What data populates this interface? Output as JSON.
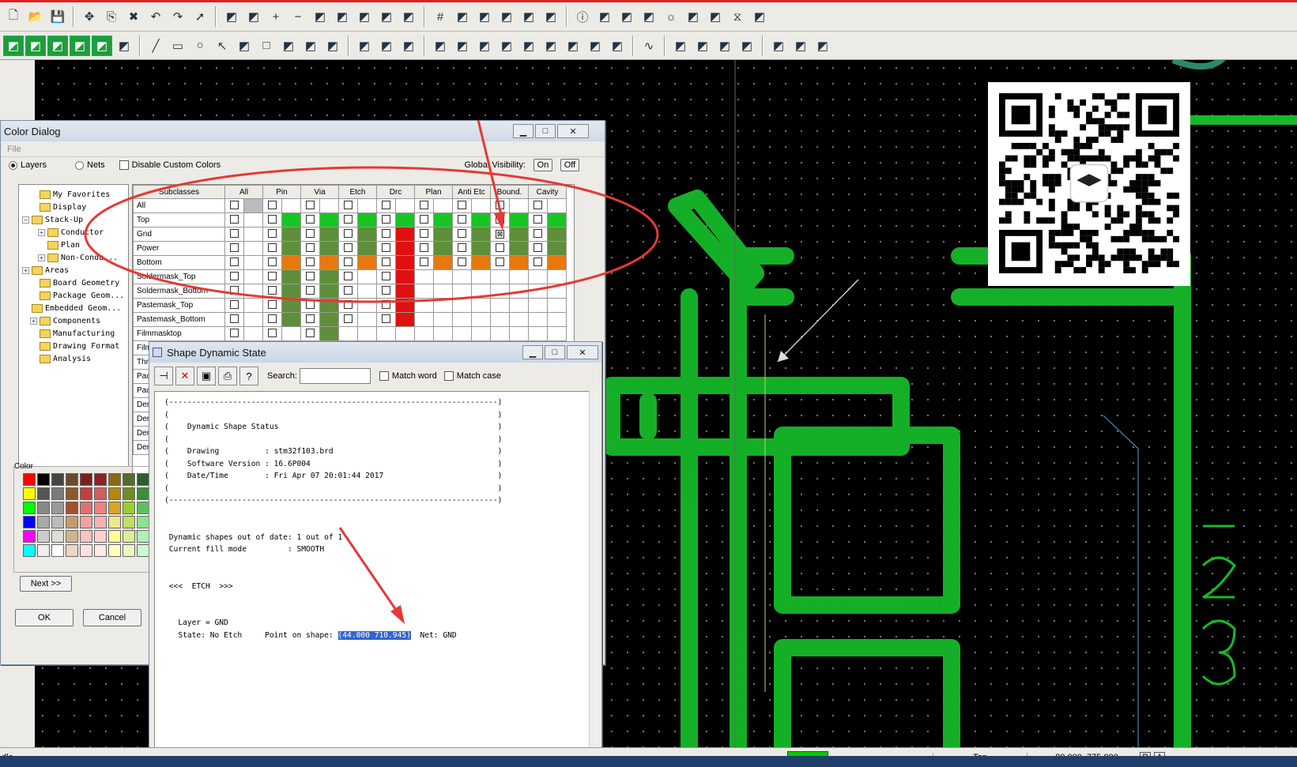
{
  "color_dialog": {
    "title": "Color Dialog",
    "menu_file": "File",
    "layers_label": "Layers",
    "nets_label": "Nets",
    "disable_custom_colors": "Disable Custom Colors",
    "global_visibility": "Global Visibility:",
    "on_label": "On",
    "off_label": "Off",
    "tree": [
      "My Favorites",
      "Display",
      "Stack-Up",
      "Conductor",
      "Plan",
      "Non-Condu...",
      "Areas",
      "Board Geometry",
      "Package Geom...",
      "Embedded Geom...",
      "Components",
      "Manufacturing",
      "Drawing Format",
      "Analysis"
    ],
    "columns": [
      "Subclasses",
      "All",
      "Pin",
      "Via",
      "Etch",
      "Drc",
      "Plan",
      "Anti Etc",
      "Bound.",
      "Cavity"
    ],
    "rows": [
      "All",
      "Top",
      "Gnd",
      "Power",
      "Bottom",
      "Soldermask_Top",
      "Soldermask_Bottom",
      "Pastemask_Top",
      "Pastemask_Bottom",
      "Filmmasktop",
      "Filmmaskbottom",
      "Thru",
      "Pac",
      "Pac",
      "Dem",
      "Dem",
      "Dem",
      "Dem"
    ],
    "color_label": "Color",
    "next_button": "Next >>",
    "ok_button": "OK",
    "cancel_button": "Cancel"
  },
  "shape_window": {
    "title": "Shape Dynamic State",
    "search_label": "Search:",
    "search_value": "",
    "match_word": "Match word",
    "match_case": "Match case",
    "lines": {
      "border": "(------------------------------------------------------------------------)",
      "blank": "(                                                                        )",
      "heading": "(    Dynamic Shape Status                                                )",
      "drawing": "(    Drawing          : stm32f103.brd                                    )",
      "version": "(    Software Version : 16.6P004                                         )",
      "date": "(    Date/Time        : Fri Apr 07 20:01:44 2017                         )",
      "out_of_date": "Dynamic shapes out of date: 1 out of 1",
      "fill_mode": "Current fill mode         : SMOOTH",
      "etch": "<<<  ETCH  >>>",
      "layer": "Layer = GND",
      "state_prefix": "   State: No Etch     Point on shape: ",
      "point": "(44.000 710.945)",
      "net_suffix": "  Net: GND"
    }
  },
  "status_bar": {
    "mode": "dle",
    "layer": "Top",
    "coords": "80.000, 775.000",
    "p": "P",
    "a": "A"
  },
  "colors": {
    "pcb_green": "#17b92a",
    "annotation_red": "#e53935",
    "swatch_green": "#17c623",
    "swatch_olive": "#5f8f3a",
    "swatch_red": "#e01010",
    "swatch_orange": "#e8780e",
    "selection_blue": "#3366cc"
  }
}
